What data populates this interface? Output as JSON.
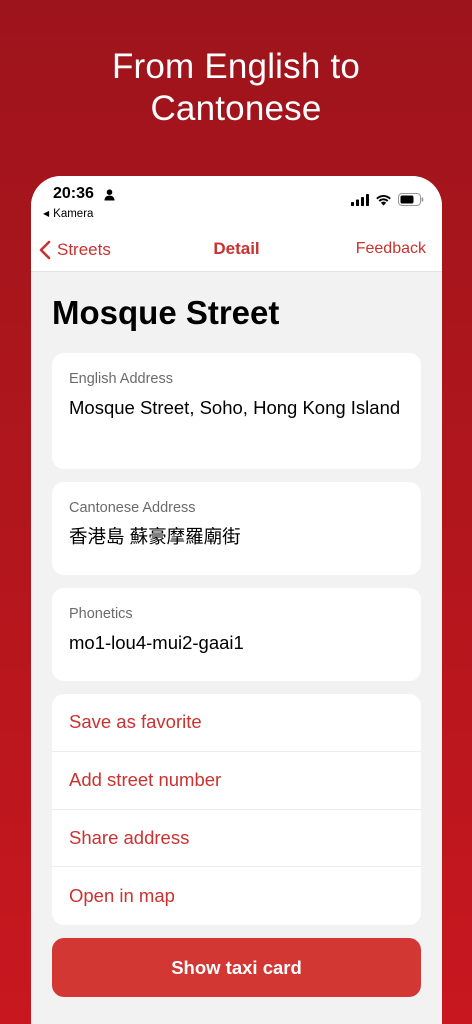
{
  "headline": {
    "line1": "From English to",
    "line2": "Cantonese"
  },
  "status_bar": {
    "time": "20:36",
    "back_app": "Kamera",
    "icons": [
      "person-icon",
      "signal-icon",
      "wifi-icon",
      "battery-icon"
    ]
  },
  "nav": {
    "back_label": "Streets",
    "title": "Detail",
    "action_label": "Feedback"
  },
  "page_title": "Mosque Street",
  "cards": {
    "english": {
      "label": "English Address",
      "value": "Mosque Street, Soho, Hong Kong Island"
    },
    "cantonese": {
      "label": "Cantonese Address",
      "value": "香港島 蘇豪摩羅廟街"
    },
    "phonetics": {
      "label": "Phonetics",
      "value": "mo1-lou4-mui2-gaai1"
    }
  },
  "actions": [
    {
      "label": "Save as favorite"
    },
    {
      "label": "Add street number"
    },
    {
      "label": "Share address"
    },
    {
      "label": "Open in map"
    }
  ],
  "taxi_button": {
    "label": "Show taxi card"
  },
  "colors": {
    "accent": "#c9322f",
    "button": "#d23733",
    "background_top": "#9e141c",
    "background_bottom": "#c8171f"
  }
}
